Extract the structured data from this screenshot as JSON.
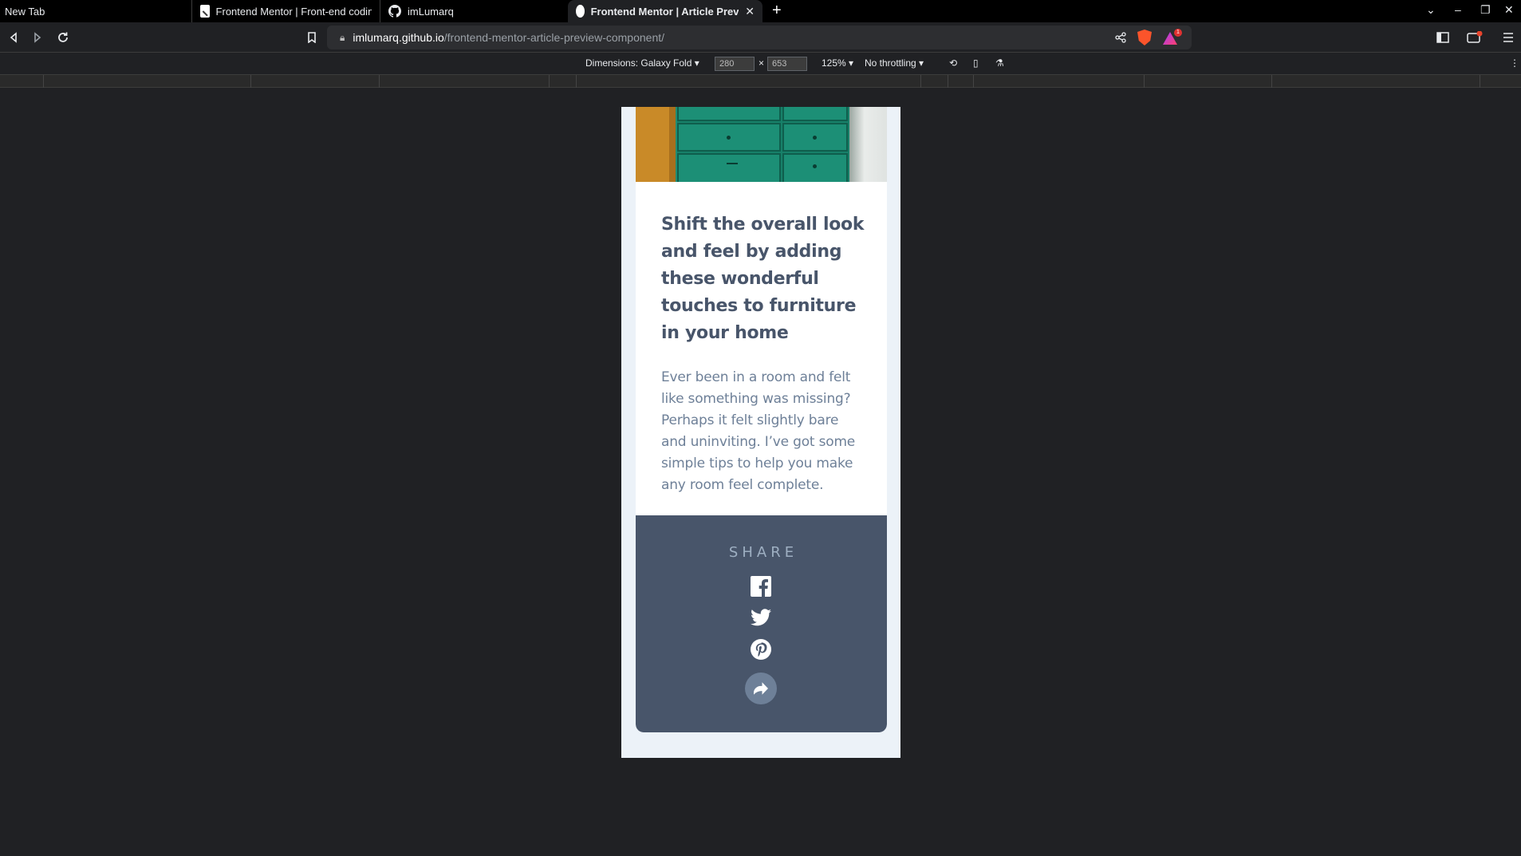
{
  "browser": {
    "tabs": [
      {
        "label": "New Tab"
      },
      {
        "label": "Frontend Mentor | Front-end coding challenges"
      },
      {
        "label": "imLumarq"
      },
      {
        "label": "Frontend Mentor | Article Preview component"
      }
    ],
    "address": {
      "host": "imlumarq.github.io",
      "path": "/frontend-mentor-article-preview-component/"
    }
  },
  "devtools": {
    "dimensions_label": "Dimensions: Galaxy Fold",
    "width": "280",
    "height": "653",
    "zoom": "125%",
    "throttling": "No throttling"
  },
  "article": {
    "title": "Shift the overall look and feel by adding these wonderful touches to furniture in your home",
    "description": "Ever been in a room and felt like something was missing? Perhaps it felt slightly bare and uninviting. I’ve got some simple tips to help you make any room feel complete.",
    "share_label": "SHARE",
    "social_icons": [
      "facebook-icon",
      "twitter-icon",
      "pinterest-icon"
    ],
    "share_button_icon": "share-arrow-icon"
  },
  "colors": {
    "page_bg": "#202124",
    "viewport_bg": "#ecf2f8",
    "title": "#48556a",
    "body_text": "#6e8098",
    "share_panel": "#48556a",
    "share_label": "#9eafc2",
    "share_button": "#6e8098"
  }
}
